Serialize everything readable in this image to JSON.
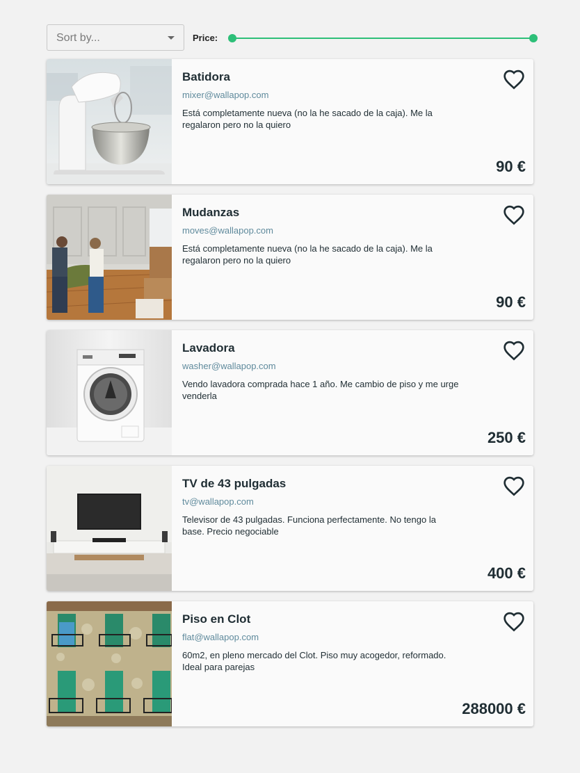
{
  "filters": {
    "sort_placeholder": "Sort by...",
    "price_label": "Price:",
    "accent_color": "#2dbf78"
  },
  "items": [
    {
      "title": "Batidora",
      "email": "mixer@wallapop.com",
      "description": "Está completamente nueva (no la he sacado de la caja). Me la regalaron pero no la quiero",
      "price": "90 €",
      "image": "stand-mixer-photo"
    },
    {
      "title": "Mudanzas",
      "email": "moves@wallapop.com",
      "description": "Está completamente nueva (no la he sacado de la caja). Me la regalaron pero no la quiero",
      "price": "90 €",
      "image": "couple-moving-sofa-photo"
    },
    {
      "title": "Lavadora",
      "email": "washer@wallapop.com",
      "description": "Vendo lavadora comprada hace 1 año. Me cambio de piso y me urge venderla",
      "price": "250 €",
      "image": "washing-machine-photo"
    },
    {
      "title": "TV de 43 pulgadas",
      "email": "tv@wallapop.com",
      "description": "Televisor de 43 pulgadas. Funciona perfectamente. No tengo la base. Precio negociable",
      "price": "400 €",
      "image": "wall-mounted-tv-photo"
    },
    {
      "title": "Piso en Clot",
      "email": "flat@wallapop.com",
      "description": "60m2, en pleno mercado del Clot. Piso muy acogedor, reformado. Ideal para parejas",
      "price": "288000 €",
      "image": "building-facade-photo"
    }
  ]
}
